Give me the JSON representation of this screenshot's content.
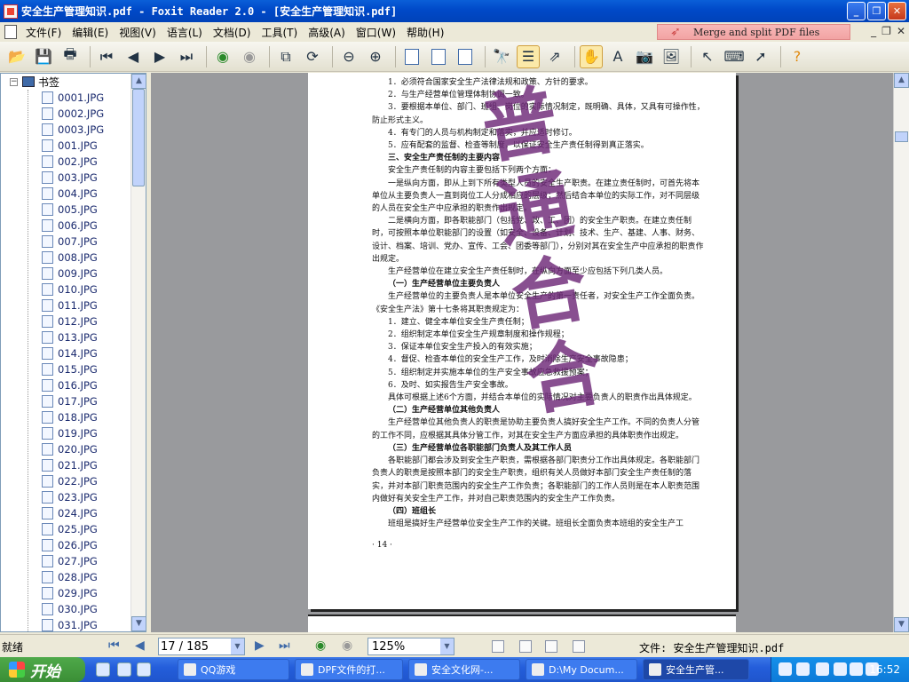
{
  "window": {
    "title": "安全生产管理知识.pdf - Foxit Reader 2.0 - [安全生产管理知识.pdf]"
  },
  "window_controls": {
    "minimize": "_",
    "restore": "❐",
    "close": "✕"
  },
  "menu": [
    "文件(F)",
    "编辑(E)",
    "视图(V)",
    "语言(L)",
    "文档(D)",
    "工具(T)",
    "高级(A)",
    "窗口(W)",
    "帮助(H)"
  ],
  "promo": {
    "label": "Merge and split PDF files",
    "icon": "pointer-arrow-icon"
  },
  "mdi_controls": {
    "minimize": "_",
    "restore": "❐",
    "close": "✕"
  },
  "toolbar": {
    "buttons": [
      "open-icon",
      "save-icon",
      "print-icon",
      "first-page-icon",
      "prev-page-icon",
      "next-page-icon",
      "last-page-icon",
      "back-icon",
      "forward-icon",
      "extract-icon",
      "rotate-icon",
      "zoom-out-icon",
      "zoom-in-icon",
      "actual-size-icon",
      "fit-page-icon",
      "fit-width-icon",
      "find-icon",
      "continuous-icon",
      "fit-visible-icon",
      "hand-tool-icon",
      "text-select-icon",
      "snapshot-icon",
      "image-icon",
      "select-icon",
      "typewriter-icon",
      "arrow-tool-icon",
      "help-icon"
    ]
  },
  "sidebar": {
    "root_label": "书签",
    "root_toggle": "−",
    "items": [
      "0001.JPG",
      "0002.JPG",
      "0003.JPG",
      "001.JPG",
      "002.JPG",
      "003.JPG",
      "004.JPG",
      "005.JPG",
      "006.JPG",
      "007.JPG",
      "008.JPG",
      "009.JPG",
      "010.JPG",
      "011.JPG",
      "012.JPG",
      "013.JPG",
      "014.JPG",
      "015.JPG",
      "016.JPG",
      "017.JPG",
      "018.JPG",
      "019.JPG",
      "020.JPG",
      "021.JPG",
      "022.JPG",
      "023.JPG",
      "024.JPG",
      "025.JPG",
      "026.JPG",
      "027.JPG",
      "028.JPG",
      "029.JPG",
      "030.JPG",
      "031.JPG"
    ]
  },
  "document": {
    "lines": [
      "1．必须符合国家安全生产法律法规和政策、方针的要求。",
      "2．与生产经营单位管理体制协调一致。",
      "3．要根据本单位、部门、班组、岗位的实际情况制定，既明确、具体，又具有可操作性，防止形式主义。",
      "4．有专门的人员与机构制定和落实，并应适时修订。",
      "5．应有配套的监督、检查等制度，以保证安全生产责任制得到真正落实。",
      "三、安全生产责任制的主要内容",
      "安全生产责任制的内容主要包括下列两个方面：",
      "一是纵向方面，即从上到下所有类型人员的安全生产职责。在建立责任制时，可首先将本单位从主要负责人一直到岗位工人分成相应的层级；然后结合本单位的实际工作，对不同层级的人员在安全生产中应承担的职责作出规定。",
      "二是横向方面，即各职能部门（包括党、政、工、团）的安全生产职责。在建立责任制时，可按照本单位职能部门的设置（如安全、设备、计划、技术、生产、基建、人事、财务、设计、档案、培训、党办、宣传、工会、团委等部门），分别对其在安全生产中应承担的职责作出规定。",
      "生产经营单位在建立安全生产责任制时，在纵向方面至少应包括下列几类人员。",
      "（一）生产经营单位主要负责人",
      "生产经营单位的主要负责人是本单位安全生产的第一责任者，对安全生产工作全面负责。《安全生产法》第十七条将其职责规定为：",
      "1．建立、健全本单位安全生产责任制；",
      "2．组织制定本单位安全生产规章制度和操作规程；",
      "3．保证本单位安全生产投入的有效实施；",
      "4．督促、检查本单位的安全生产工作，及时消除生产安全事故隐患；",
      "5．组织制定并实施本单位的生产安全事故应急救援预案；",
      "6．及时、如实报告生产安全事故。",
      "具体可根据上述6个方面，并结合本单位的实际情况对主要负责人的职责作出具体规定。",
      "（二）生产经营单位其他负责人",
      "生产经营单位其他负责人的职责是协助主要负责人搞好安全生产工作。不同的负责人分管的工作不同，应根据其具体分管工作，对其在安全生产方面应承担的具体职责作出规定。",
      "（三）生产经营单位各职能部门负责人及其工作人员",
      "各职能部门都会涉及到安全生产职责，需根据各部门职责分工作出具体规定。各职能部门负责人的职责是按照本部门的安全生产职责，组织有关人员做好本部门安全生产责任制的落实，并对本部门职责范围内的安全生产工作负责；各职能部门的工作人员则是在本人职责范围内做好有关安全生产工作，并对自己职责范围内的安全生产工作负责。",
      "（四）班组长",
      "班组是搞好生产经营单位安全生产工作的关键。班组长全面负责本班组的安全生产工"
    ],
    "page_number": "· 14 ·",
    "stamp_text": "普通合合"
  },
  "statusbar": {
    "status": "就绪",
    "page_field": "17 / 185",
    "zoom": "125%",
    "file_label": "文件: 安全生产管理知识.pdf"
  },
  "taskbar": {
    "start_label": "开始",
    "tasks": [
      "QQ游戏",
      "DPF文件的打...",
      "安全文化网-...",
      "D:\\My Docum...",
      "安全生产管..."
    ],
    "clock": "16:52"
  }
}
